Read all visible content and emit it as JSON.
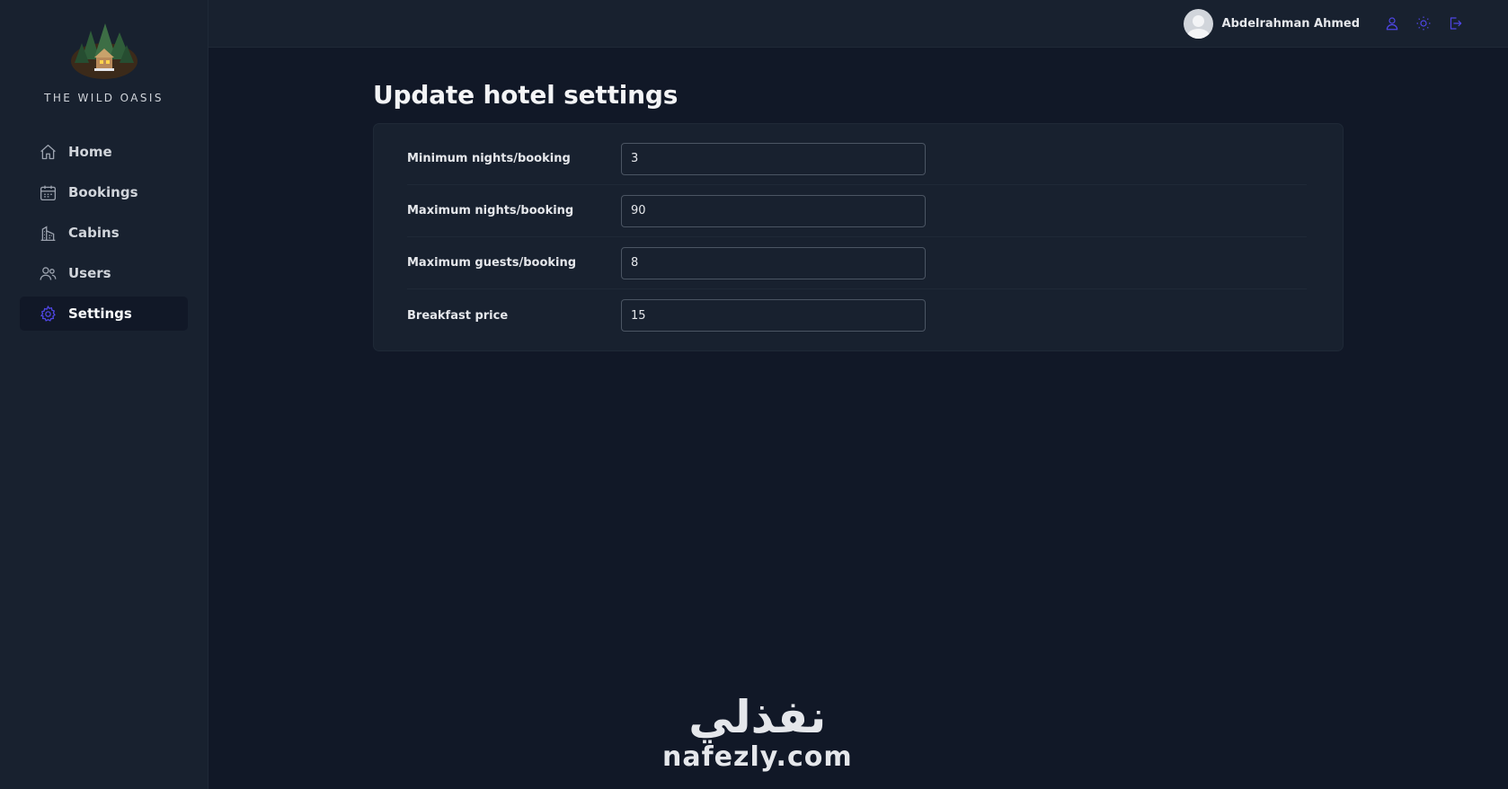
{
  "brand": {
    "name": "THE WILD OASIS"
  },
  "sidebar": {
    "items": [
      {
        "label": "Home",
        "icon": "home-icon",
        "active": false
      },
      {
        "label": "Bookings",
        "icon": "calendar-icon",
        "active": false
      },
      {
        "label": "Cabins",
        "icon": "building-icon",
        "active": false
      },
      {
        "label": "Users",
        "icon": "users-icon",
        "active": false
      },
      {
        "label": "Settings",
        "icon": "gear-icon",
        "active": true
      }
    ]
  },
  "header": {
    "user_name": "Abdelrahman Ahmed",
    "actions": [
      "user-icon",
      "sun-icon",
      "logout-icon"
    ]
  },
  "page": {
    "title": "Update hotel settings",
    "fields": [
      {
        "label": "Minimum nights/booking",
        "value": "3"
      },
      {
        "label": "Maximum nights/booking",
        "value": "90"
      },
      {
        "label": "Maximum guests/booking",
        "value": "8"
      },
      {
        "label": "Breakfast price",
        "value": "15"
      }
    ]
  },
  "watermark": {
    "arabic": "نفذلي",
    "latin": "nafezly.com"
  },
  "colors": {
    "background": "#111827",
    "panel": "#18212f",
    "accent": "#4f46e5",
    "text": "#e5e7eb"
  }
}
